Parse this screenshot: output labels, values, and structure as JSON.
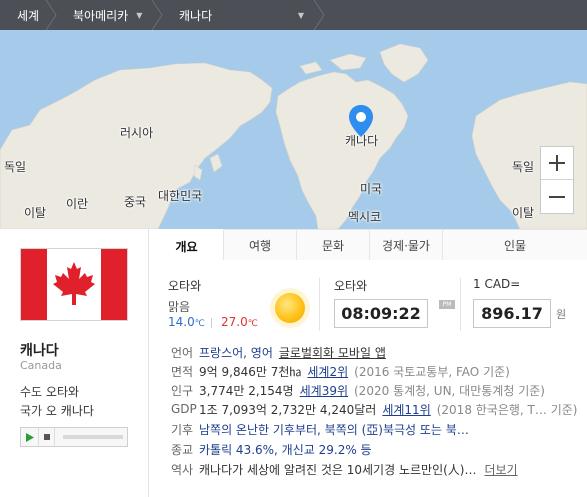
{
  "breadcrumb": {
    "items": [
      "세계",
      "북아메리카",
      "캐나다"
    ]
  },
  "map": {
    "labels": {
      "russia": "러시아",
      "canada": "캐나다",
      "germany_left": "독일",
      "germany_right": "독일",
      "italy_left": "이탈",
      "italy_right": "이탈",
      "iran": "이란",
      "china": "중국",
      "korea": "대한민국",
      "usa": "미국",
      "mexico": "멕시코"
    },
    "colors": {
      "water": "#a6cbea",
      "land": "#ece9e1",
      "pin": "#2e8ef0"
    }
  },
  "country": {
    "name": "캐나다",
    "name_en": "Canada",
    "capital_label": "수도",
    "capital": "오타와",
    "anthem_label": "국가",
    "anthem": "오 캐나다"
  },
  "tabs": [
    "개요",
    "여행",
    "문화",
    "경제·물가",
    "인물"
  ],
  "weather": {
    "city": "오타와",
    "condition": "맑음",
    "min": "14.0",
    "max": "27.0",
    "unit": "℃"
  },
  "time": {
    "city": "오타와",
    "clock": "08:09:22",
    "ampm": "PM"
  },
  "currency": {
    "label": "1 CAD=",
    "value": "896.17",
    "unit": "원"
  },
  "info": {
    "language": {
      "key": "언어",
      "value": "프랑스어, 영어",
      "link": "글로벌회화 모바일 앱"
    },
    "area": {
      "key": "면적",
      "value": "9억 9,846만 7천㏊",
      "rank": "세계2위",
      "source": "(2016 국토교통부, FAO 기준)"
    },
    "population": {
      "key": "인구",
      "value": "3,774만 2,154명",
      "rank": "세계39위",
      "source": "(2020 통계청, UN, 대만통계청 기준)"
    },
    "gdp": {
      "key": "GDP",
      "value": "1조 7,093억 2,732만 4,240달러",
      "rank": "세계11위",
      "source": "(2018 한국은행, T… 기준)"
    },
    "climate": {
      "key": "기후",
      "value": "남쪽의 온난한 기후부터, 북쪽의 (亞)북극성 또는 북…"
    },
    "religion": {
      "key": "종교",
      "value": "카톨릭 43.6%, 개신교 29.2% 등"
    },
    "history": {
      "key": "역사",
      "value": "캐나다가 세상에 알려진 것은 10세기경 노르만인(人)…",
      "more": "더보기"
    }
  }
}
